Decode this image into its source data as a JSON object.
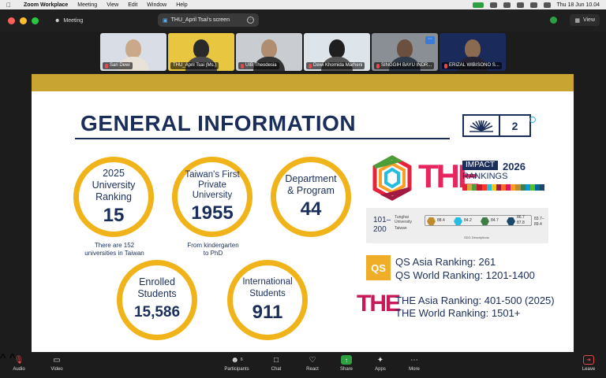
{
  "menubar": {
    "app_name": "Zoom Workplace",
    "menu_items": [
      "Meeting",
      "View",
      "Edit",
      "Window",
      "Help"
    ],
    "clock": "Thu 18 Jun  10.04"
  },
  "window": {
    "meeting_label": "Meeting",
    "share_pill": "THU_April Tsai's screen",
    "view_label": "View"
  },
  "participants": [
    {
      "name": "Sari Dewi",
      "muted": true
    },
    {
      "name": "THU_April Tsai (Ms.)",
      "muted": false,
      "active": true
    },
    {
      "name": "UIB Theodesia",
      "muted": true
    },
    {
      "name": "Dewi Khornida Marheni",
      "muted": true
    },
    {
      "name": "SINGGIH BAYU INDR...",
      "muted": true
    },
    {
      "name": "ERIZAL WIBISONO S...",
      "muted": true
    }
  ],
  "slide": {
    "title": "GENERAL INFORMATION",
    "page_number": "2",
    "circles": {
      "ranking": {
        "label1": "2025",
        "label2": "University",
        "label3": "Ranking",
        "value": "15"
      },
      "private": {
        "label1": "Taiwan's First",
        "label2": "Private",
        "label3": "University",
        "value": "1955"
      },
      "dept": {
        "label1": "Department",
        "label2": "& Program",
        "value": "44"
      },
      "enrolled": {
        "label1": "Enrolled",
        "label2": "Students",
        "value": "15,586"
      },
      "intl": {
        "label1": "International",
        "label2": "Students",
        "value": "911"
      }
    },
    "notes": {
      "ranking_note1": "There are 152",
      "ranking_note2": "universities in Taiwan",
      "private_note1": "From kindergarten",
      "private_note2": "to PhD"
    },
    "the_impact": {
      "the": "THE",
      "impact": "IMPACT",
      "rankings": "RANKINGS",
      "year": "2026"
    },
    "rank_card": {
      "range_top": "101–",
      "range_bottom": "200",
      "university": "Tunghai",
      "university2": "University",
      "location": "Taiwan",
      "scores": [
        {
          "sdg": "12",
          "score": "88.4",
          "color": "#bf8b2e"
        },
        {
          "sdg": "6",
          "score": "84.2",
          "color": "#26bde2"
        },
        {
          "sdg": "13",
          "score": "84.7",
          "color": "#3f7e44"
        },
        {
          "sdg": "17",
          "score": "86.7",
          "score2": "87.8",
          "color": "#19486a"
        }
      ],
      "overall1": "83.7–",
      "overall2": "89.4",
      "sdg_note": "SDG Descriptions"
    },
    "qs": {
      "logo": "QS",
      "asia": "QS Asia Ranking: 261",
      "world": "QS World Ranking: 1201-1400"
    },
    "the_rank": {
      "logo": "THE",
      "asia": "THE Asia Ranking: 401-500 (2025)",
      "world": "THE World Ranking: 1501+"
    }
  },
  "controls": {
    "audio": "Audio",
    "video": "Video",
    "participants": "Participants",
    "participants_count": "6",
    "chat": "Chat",
    "react": "React",
    "share": "Share",
    "apps": "Apps",
    "more": "More",
    "leave": "Leave"
  }
}
